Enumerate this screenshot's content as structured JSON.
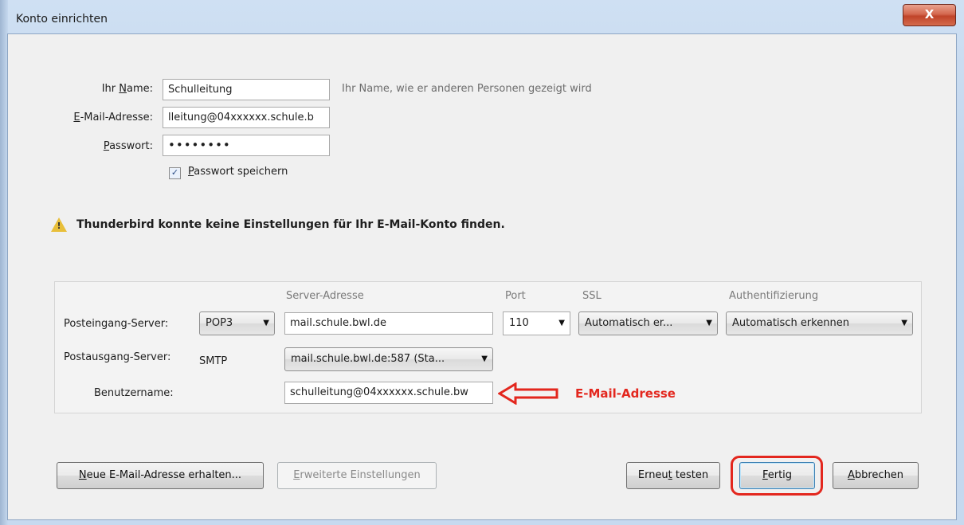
{
  "window": {
    "title": "Konto einrichten",
    "close_glyph": "X"
  },
  "form": {
    "name": {
      "label_prefix": "Ihr ",
      "label_key": "N",
      "label_rest": "ame:",
      "value": "Schulleitung",
      "hint": "Ihr Name, wie er anderen Personen gezeigt wird"
    },
    "email": {
      "label_key": "E",
      "label_rest": "-Mail-Adresse:",
      "value": "lleitung@04xxxxxx.schule.b"
    },
    "password": {
      "label_key": "P",
      "label_rest": "asswort:",
      "value": "••••••••"
    },
    "remember": {
      "label_key": "P",
      "label_rest": "asswort speichern",
      "checked": true
    }
  },
  "warning": {
    "icon": "warning-triangle-icon",
    "text": "Thunderbird konnte keine Einstellungen für Ihr E-Mail-Konto finden."
  },
  "server": {
    "columns": {
      "address": "Server-Adresse",
      "port": "Port",
      "ssl": "SSL",
      "auth": "Authentifizierung"
    },
    "incoming": {
      "label": "Posteingang-Server:",
      "protocol": "POP3",
      "address": "mail.schule.bwl.de",
      "port": "110",
      "ssl": "Automatisch er...",
      "auth": "Automatisch erkennen"
    },
    "outgoing": {
      "label": "Postausgang-Server:",
      "protocol": "SMTP",
      "address": "mail.schule.bwl.de:587 (Sta..."
    },
    "username": {
      "label": "Benutzername:",
      "value": "schulleitung@04xxxxxx.schule.bw"
    }
  },
  "annotation": {
    "text": "E-Mail-Adresse",
    "color": "#e3271e"
  },
  "buttons": {
    "new_address": {
      "key": "N",
      "rest": "eue E-Mail-Adresse erhalten..."
    },
    "advanced": {
      "key": "E",
      "rest": "rweiterte Einstellungen"
    },
    "retest": {
      "pre": "Erneu",
      "key": "t",
      "rest": " testen"
    },
    "done": {
      "key": "F",
      "rest": "ertig"
    },
    "cancel": {
      "key": "A",
      "rest": "bbrechen"
    }
  }
}
